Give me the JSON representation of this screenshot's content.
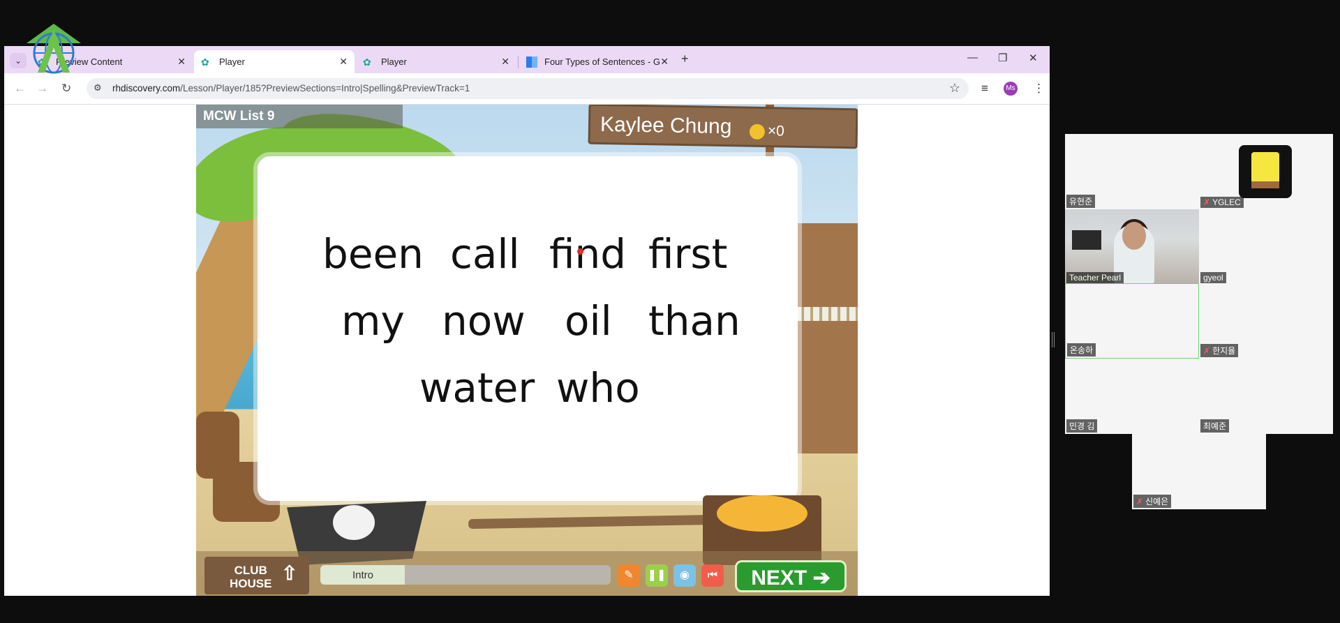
{
  "browser": {
    "tabs": [
      {
        "title": "Preview Content",
        "active": false
      },
      {
        "title": "Player",
        "active": true
      },
      {
        "title": "Player",
        "active": false
      },
      {
        "title": "Four Types of Sentences - Grou",
        "active": false
      }
    ],
    "url_domain": "rhdiscovery.com",
    "url_path": "/Lesson/Player/185?PreviewSections=Intro|Spelling&PreviewTrack=1",
    "profile_initials": "Ms"
  },
  "game": {
    "list_title": "MCW List 9",
    "player_name": "Kaylee Chung",
    "coin_count": "×0",
    "words": [
      "been",
      "call",
      "find",
      "first",
      "my",
      "now",
      "oil",
      "than",
      "water",
      "who"
    ],
    "clubhouse_label": "CLUB\nHOUSE",
    "progress_label": "Intro",
    "progress_fraction": 0.29,
    "next_label": "NEXT"
  },
  "gallery": [
    {
      "name": "유현준",
      "muted": false
    },
    {
      "name": "YGLEC",
      "muted": true
    },
    {
      "name": "Teacher Pearl",
      "muted": false
    },
    {
      "name": "gyeol",
      "muted": false
    },
    {
      "name": "온송하",
      "muted": false
    },
    {
      "name": "한지율",
      "muted": true
    },
    {
      "name": "민경 김",
      "muted": false
    },
    {
      "name": "최예준",
      "muted": false
    },
    {
      "name": "신예은",
      "muted": true
    }
  ],
  "colors": {
    "tab_strip": "#ecd9f6",
    "next_button": "#2b9b2f",
    "profile": "#9c3bb5"
  }
}
